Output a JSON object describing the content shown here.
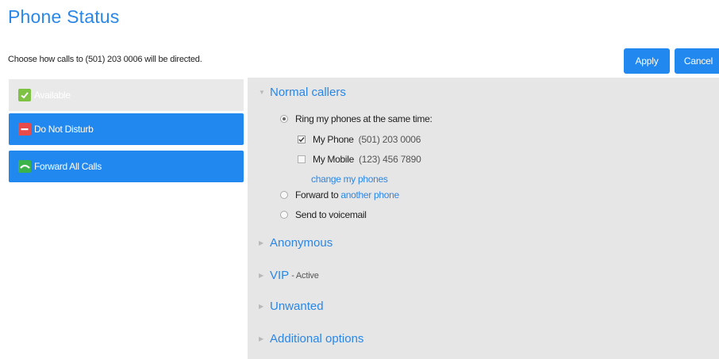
{
  "page": {
    "title": "Phone Status",
    "description": "Choose how calls to (501) 203 0006 will be directed."
  },
  "actions": {
    "apply_label": "Apply",
    "cancel_label": "Cancel"
  },
  "statuses": [
    {
      "label": "Available",
      "icon": "check-icon",
      "selected": false
    },
    {
      "label": "Do Not Disturb",
      "icon": "do-not-disturb-icon",
      "selected": true
    },
    {
      "label": "Forward All Calls",
      "icon": "forward-call-icon",
      "selected": true
    }
  ],
  "sections": {
    "normal": {
      "title": "Normal callers",
      "expanded": true,
      "ring_label": "Ring my phones at the same time:",
      "phones": [
        {
          "name": "My Phone",
          "number": "(501) 203 0006",
          "checked": true
        },
        {
          "name": "My Mobile",
          "number": "(123) 456 7890",
          "checked": false
        }
      ],
      "change_link": "change my phones",
      "forward_prefix": "Forward to",
      "forward_link": "another phone",
      "voicemail_label": "Send to voicemail",
      "selected_option": "ring"
    },
    "anonymous": {
      "title": "Anonymous"
    },
    "vip": {
      "title": "VIP",
      "suffix": "- Active"
    },
    "unwanted": {
      "title": "Unwanted"
    },
    "additional": {
      "title": "Additional options"
    }
  },
  "colors": {
    "accent": "#2188f0",
    "title_blue": "#2a87e8",
    "panel_gray": "#e6e6e6",
    "available_green": "#7dc242",
    "dnd_red": "#e94b4b"
  }
}
